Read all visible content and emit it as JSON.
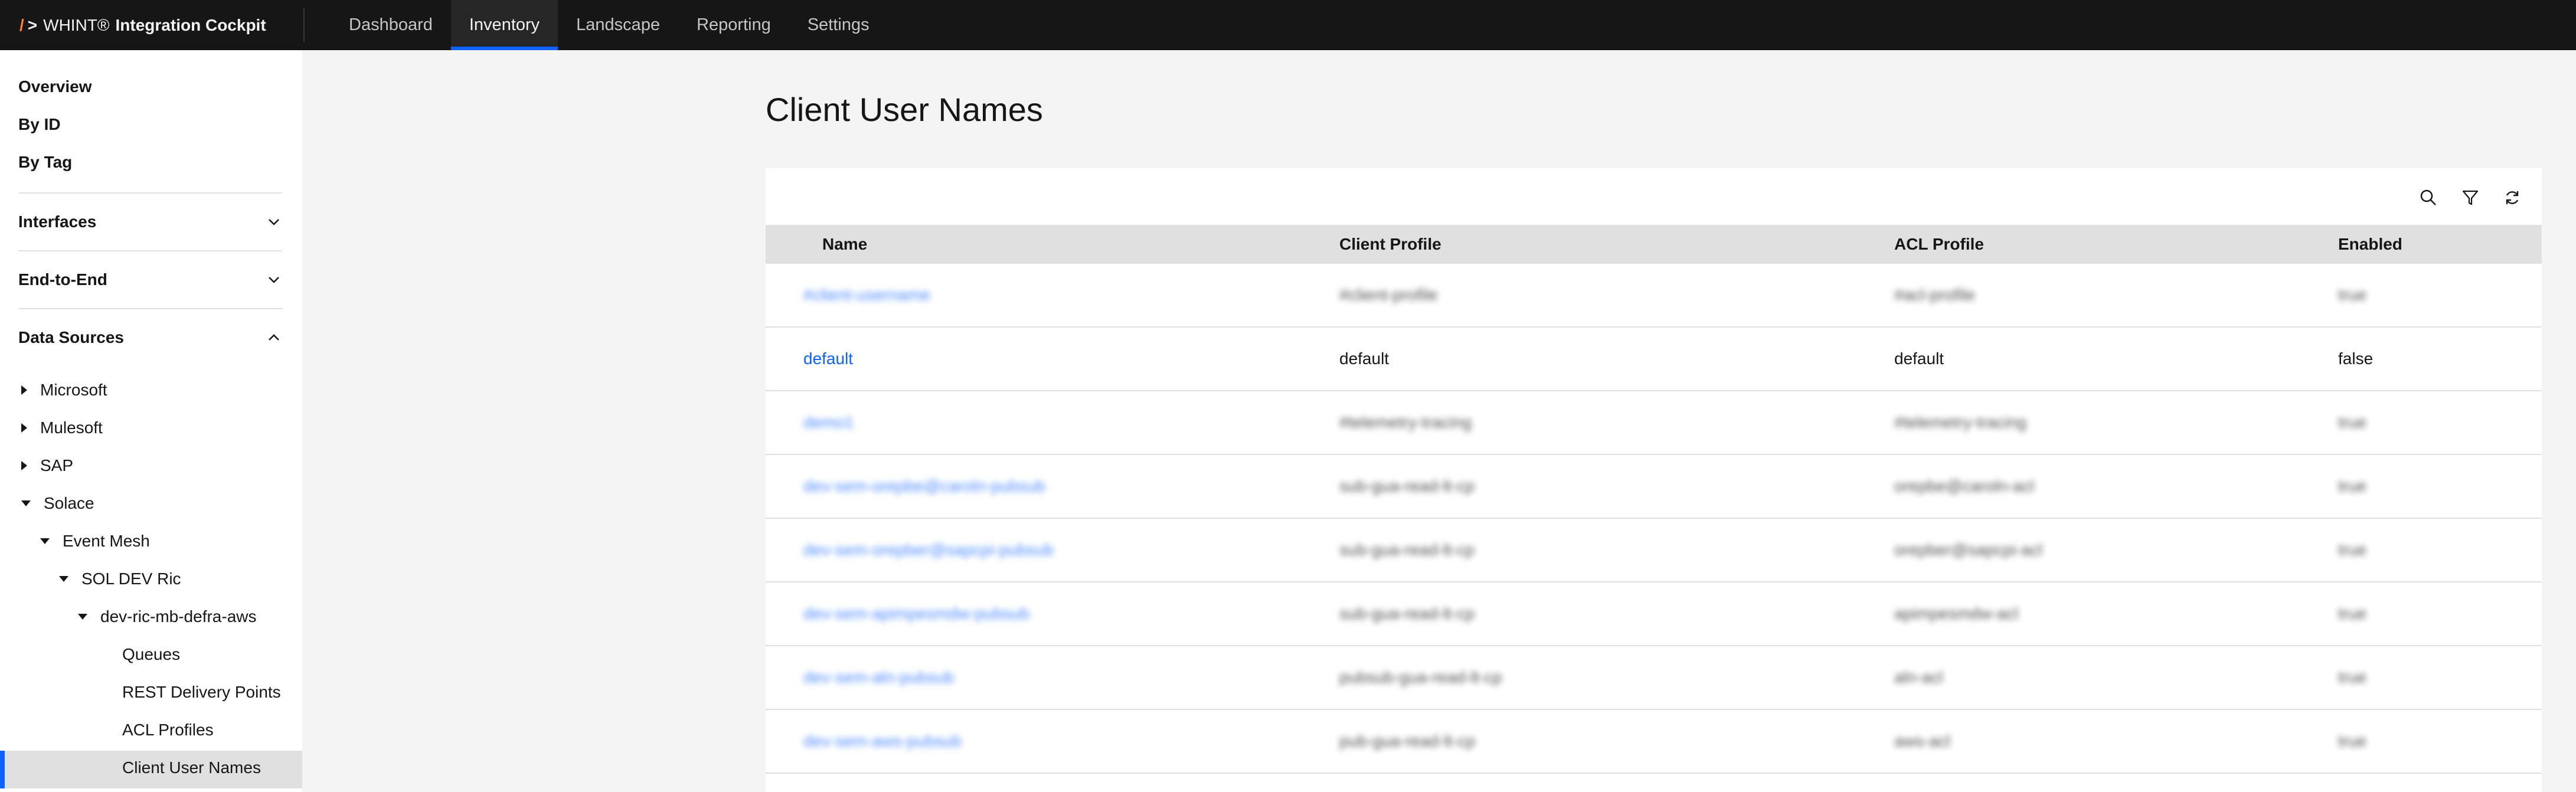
{
  "header": {
    "brand_slash": "/",
    "brand_gt": ">",
    "brand_name": "WHINT®",
    "brand_product": "Integration Cockpit",
    "nav": [
      {
        "label": "Dashboard"
      },
      {
        "label": "Inventory"
      },
      {
        "label": "Landscape"
      },
      {
        "label": "Reporting"
      },
      {
        "label": "Settings"
      }
    ],
    "active_nav": "Inventory"
  },
  "sidebar": {
    "links": [
      "Overview",
      "By ID",
      "By Tag"
    ],
    "sections": [
      {
        "label": "Interfaces",
        "expanded": false,
        "icon": "chevron-down-icon"
      },
      {
        "label": "End-to-End",
        "expanded": false,
        "icon": "chevron-down-icon"
      },
      {
        "label": "Data Sources",
        "expanded": true,
        "icon": "chevron-up-icon"
      }
    ],
    "tree": [
      {
        "label": "Microsoft",
        "caret": "right"
      },
      {
        "label": "Mulesoft",
        "caret": "right"
      },
      {
        "label": "SAP",
        "caret": "right"
      },
      {
        "label": "Solace",
        "caret": "down"
      },
      {
        "label": "Event Mesh",
        "caret": "down"
      },
      {
        "label": "SOL DEV Ric",
        "caret": "down"
      },
      {
        "label": "dev-ric-mb-defra-aws",
        "caret": "down"
      },
      {
        "label": "Queues"
      },
      {
        "label": "REST Delivery Points"
      },
      {
        "label": "ACL Profiles"
      },
      {
        "label": "Client User Names",
        "selected": true
      }
    ]
  },
  "main": {
    "title": "Client User Names",
    "toolbar_icons": [
      "search-icon",
      "filter-icon",
      "refresh-icon"
    ],
    "columns": [
      "Name",
      "Client Profile",
      "ACL Profile",
      "Enabled"
    ],
    "rows": [
      {
        "name": "#client-username",
        "client_profile": "#client-profile",
        "acl_profile": "#acl-profile",
        "enabled": "true",
        "blurred": true
      },
      {
        "name": "default",
        "client_profile": "default",
        "acl_profile": "default",
        "enabled": "false",
        "blurred": false
      },
      {
        "name": "demo1",
        "client_profile": "#telemetry-tracing",
        "acl_profile": "#telemetry-tracing",
        "enabled": "true",
        "blurred": true
      },
      {
        "name": "dev-sem-orepbe@caroln-pubsub",
        "client_profile": "sub-gua-read-lt-cp",
        "acl_profile": "orepbe@caroln-acl",
        "enabled": "true",
        "blurred": true
      },
      {
        "name": "dev-sem-orepber@sapcpi-pubsub",
        "client_profile": "sub-gua-read-lt-cp",
        "acl_profile": "orepber@sapcpi-acl",
        "enabled": "true",
        "blurred": true
      },
      {
        "name": "dev-sem-apimpesmdw-pubsub",
        "client_profile": "sub-gua-read-lt-cp",
        "acl_profile": "apimpesmdw-acl",
        "enabled": "true",
        "blurred": true
      },
      {
        "name": "dev-sem-aln-pubsub",
        "client_profile": "pubsub-gua-read-lt-cp",
        "acl_profile": "aln-acl",
        "enabled": "true",
        "blurred": true
      },
      {
        "name": "dev-sem-aws-pubsub",
        "client_profile": "pub-gua-read-lt-cp",
        "acl_profile": "aws-acl",
        "enabled": "true",
        "blurred": true
      }
    ]
  }
}
